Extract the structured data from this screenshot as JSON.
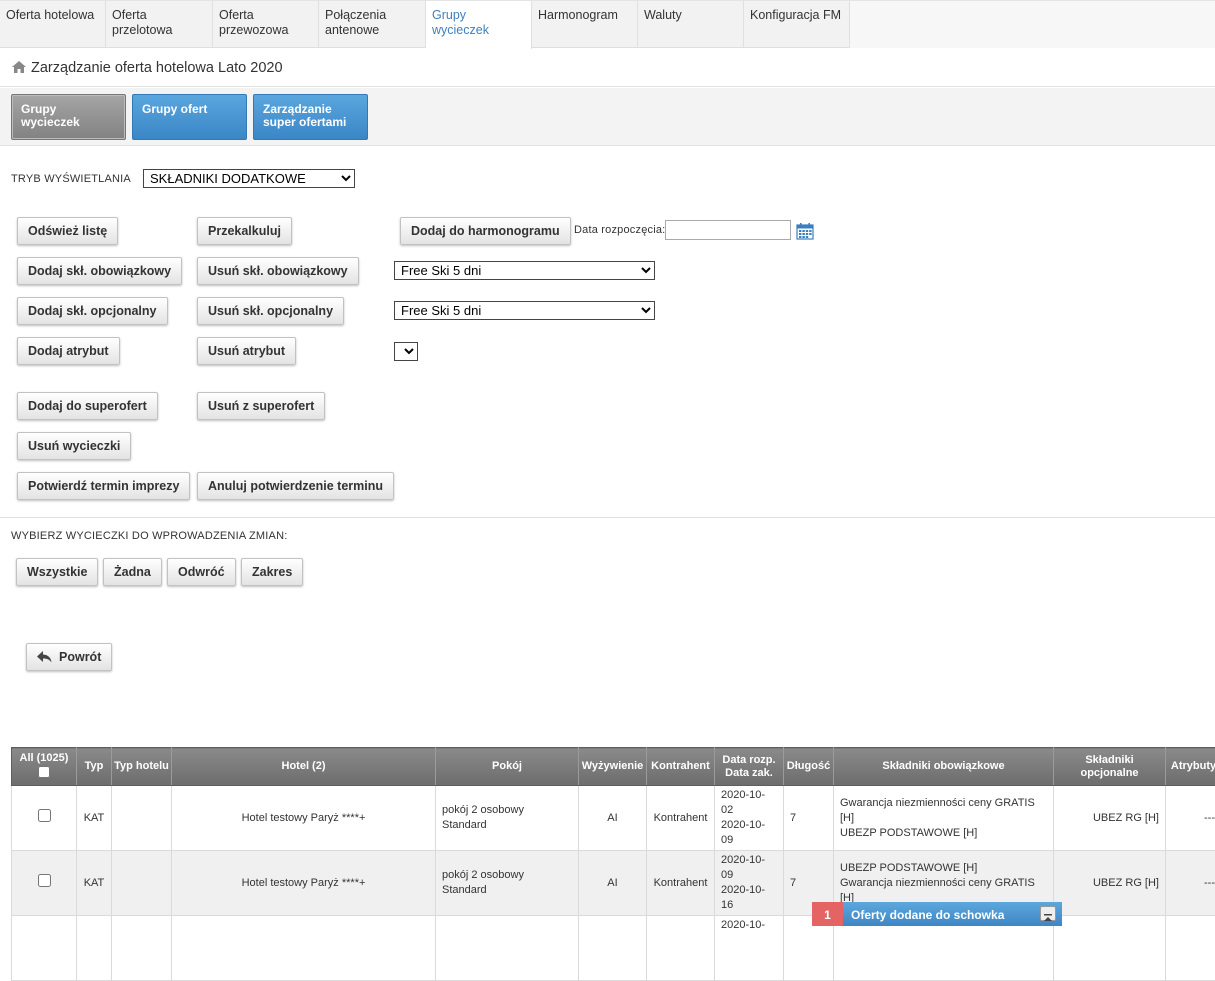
{
  "nav": {
    "tabs": [
      {
        "label": "Oferta hotelowa"
      },
      {
        "label": "Oferta przelotowa"
      },
      {
        "label": "Oferta przewozowa"
      },
      {
        "label": "Połączenia antenowe"
      },
      {
        "label": "Grupy wycieczek"
      },
      {
        "label": "Harmonogram"
      },
      {
        "label": "Waluty"
      },
      {
        "label": "Konfiguracja FM"
      }
    ],
    "active_tab": "Grupy wycieczek"
  },
  "breadcrumb": {
    "icon": "home-icon",
    "title": "Zarządzanie oferta hotelowa Lato 2020"
  },
  "subnav": {
    "grupy_wycieczek": "Grupy wycieczek",
    "grupy_ofert": "Grupy ofert",
    "super_oferty": "Zarządzanie super ofertami"
  },
  "display_mode": {
    "label": "TRYB WYŚWIETLANIA",
    "value": "SKŁADNIKI DODATKOWE"
  },
  "actions": {
    "refresh": "Odśwież listę",
    "recalc": "Przekalkuluj",
    "add_schedule": "Dodaj do harmonogramu",
    "start_date_label": "Data rozpoczęcia:",
    "start_date_value": "",
    "add_mandatory": "Dodaj skł. obowiązkowy",
    "remove_mandatory": "Usuń skł. obowiązkowy",
    "mandatory_select": "Free Ski 5 dni",
    "add_optional": "Dodaj skł. opcjonalny",
    "remove_optional": "Usuń skł. opcjonalny",
    "optional_select": "Free Ski 5 dni",
    "add_attribute": "Dodaj atrybut",
    "remove_attribute": "Usuń atrybut",
    "attribute_select": "",
    "add_super": "Dodaj do superofert",
    "remove_super": "Usuń z superofert",
    "remove_trips": "Usuń wycieczki",
    "confirm_date": "Potwierdź termin imprezy",
    "cancel_confirm": "Anuluj potwierdzenie terminu"
  },
  "selection": {
    "label": "WYBIERZ WYCIECZKI DO WPROWADZENIA ZMIAN:",
    "all": "Wszystkie",
    "none": "Żadna",
    "invert": "Odwróć",
    "range": "Zakres"
  },
  "back_label": "Powrót",
  "table": {
    "headers": {
      "all": "All (1025)",
      "typ": "Typ",
      "typ_hotelu": "Typ hotelu",
      "hotel": "Hotel (2)",
      "pokoj": "Pokój",
      "wyzywienie": "Wyżywienie",
      "kontrahent": "Kontrahent",
      "data": "Data rozp. Data zak.",
      "dlugosc": "Długość",
      "obowiazkowe": "Składniki obowiązkowe",
      "opcjonalne": "Składniki opcjonalne",
      "atrybuty": "Atrybuty"
    },
    "rows": [
      {
        "typ": "KAT",
        "typ_hotelu": "",
        "hotel": "Hotel testowy Paryż ****+",
        "pokoj_1": "pokój 2 osobowy",
        "pokoj_2": "Standard",
        "wyzywienie": "AI",
        "kontrahent": "Kontrahent",
        "data_rozp": "2020-10-02",
        "data_zak": "2020-10-09",
        "dlugosc": "7",
        "obow_1": "Gwarancja niezmienności ceny GRATIS [H]",
        "obow_2": "UBEZP PODSTAWOWE [H]",
        "opcjonalne": "UBEZ RG [H]",
        "atrybuty": "---"
      },
      {
        "typ": "KAT",
        "typ_hotelu": "",
        "hotel": "Hotel testowy Paryż ****+",
        "pokoj_1": "pokój 2 osobowy",
        "pokoj_2": "Standard",
        "wyzywienie": "AI",
        "kontrahent": "Kontrahent",
        "data_rozp": "2020-10-09",
        "data_zak": "2020-10-16",
        "dlugosc": "7",
        "obow_1": "UBEZP PODSTAWOWE [H]",
        "obow_2": "Gwarancja niezmienności ceny GRATIS [H]",
        "opcjonalne": "UBEZ RG [H]",
        "atrybuty": "---"
      },
      {
        "data_rozp": "2020-10-"
      }
    ]
  },
  "clipboard": {
    "count": "1",
    "label": "Oferty dodane do schowka"
  },
  "colors": {
    "accent_blue": "#3b86c6",
    "active_tab_text": "#3f7fbf",
    "badge_red": "#e46464"
  }
}
